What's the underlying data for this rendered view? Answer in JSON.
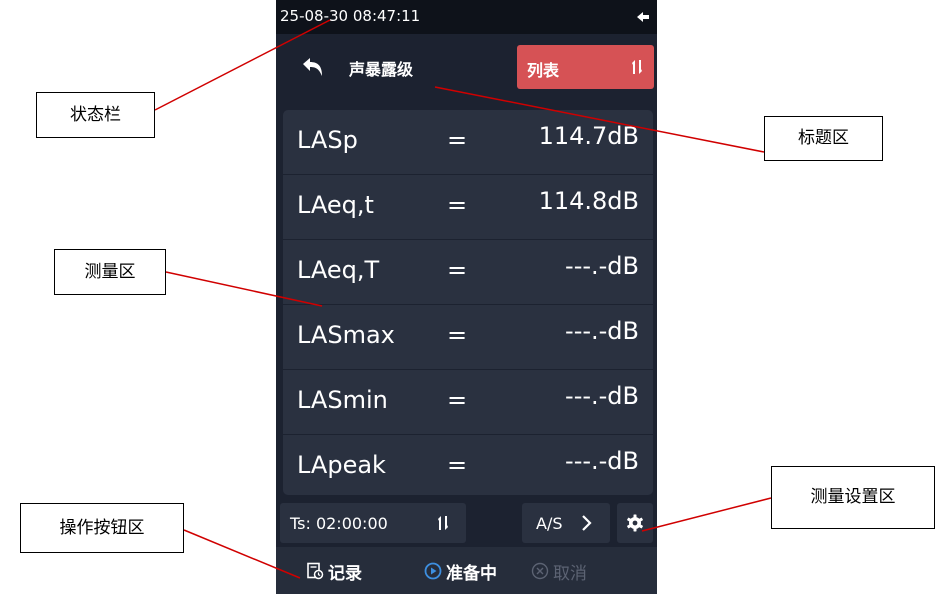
{
  "statusbar": {
    "time": "25-08-30 08:47:11",
    "battery_icon": "battery-charging-icon"
  },
  "titlebar": {
    "back_icon": "back-arrow-icon",
    "title": "声暴露级",
    "list_button": {
      "label": "列表",
      "icon": "sort-icon",
      "color": "#d65255"
    }
  },
  "measurements": [
    {
      "name": "LASp",
      "eq": "=",
      "value": "114.7dB"
    },
    {
      "name": "LAeq,t",
      "eq": "=",
      "value": "114.8dB"
    },
    {
      "name": "LAeq,T",
      "eq": "=",
      "value": "---.-dB"
    },
    {
      "name": "LASmax",
      "eq": "=",
      "value": "---.-dB"
    },
    {
      "name": "LASmin",
      "eq": "=",
      "value": "---.-dB"
    },
    {
      "name": "LApeak",
      "eq": "=",
      "value": "---.-dB"
    }
  ],
  "settings": {
    "ts_label": "Ts: 02:00:00",
    "weighting_label": "A/S",
    "gear_icon": "gear-icon"
  },
  "actions": {
    "record": "记录",
    "ready": "准备中",
    "cancel": "取消"
  },
  "callouts": {
    "statusbar": "状态栏",
    "title_area": "标题区",
    "measure_area": "测量区",
    "settings_area": "测量设置区",
    "buttons_area": "操作按钮区"
  },
  "colors": {
    "screen_bg": "#1c2230",
    "panel_bg": "#2a3140",
    "accent_red": "#d65255",
    "ready_blue": "#3d8fe0",
    "leader_red": "#d00000"
  }
}
